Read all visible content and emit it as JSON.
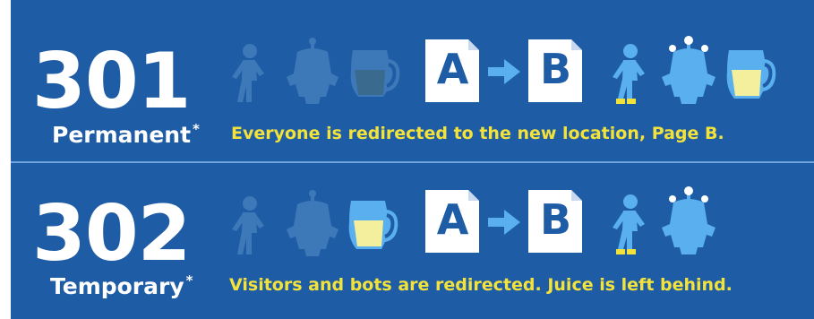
{
  "rows": [
    {
      "code": "301",
      "label": "Permanent",
      "asterisk": "*",
      "description": "Everyone is redirected to the new location, Page B.",
      "page_a": "A",
      "page_b": "B"
    },
    {
      "code": "302",
      "label": "Temporary",
      "asterisk": "*",
      "description": "Visitors and bots are redirected. Juice is left behind.",
      "page_a": "A",
      "page_b": "B"
    }
  ],
  "colors": {
    "background": "#1f5ca6",
    "divider": "#6fa3dd",
    "text": "#ffffff",
    "description": "#f3e23a",
    "icon_light": "#5ab0ee",
    "icon_faded": "#3d78b8",
    "juice": "#f4ef9c"
  }
}
